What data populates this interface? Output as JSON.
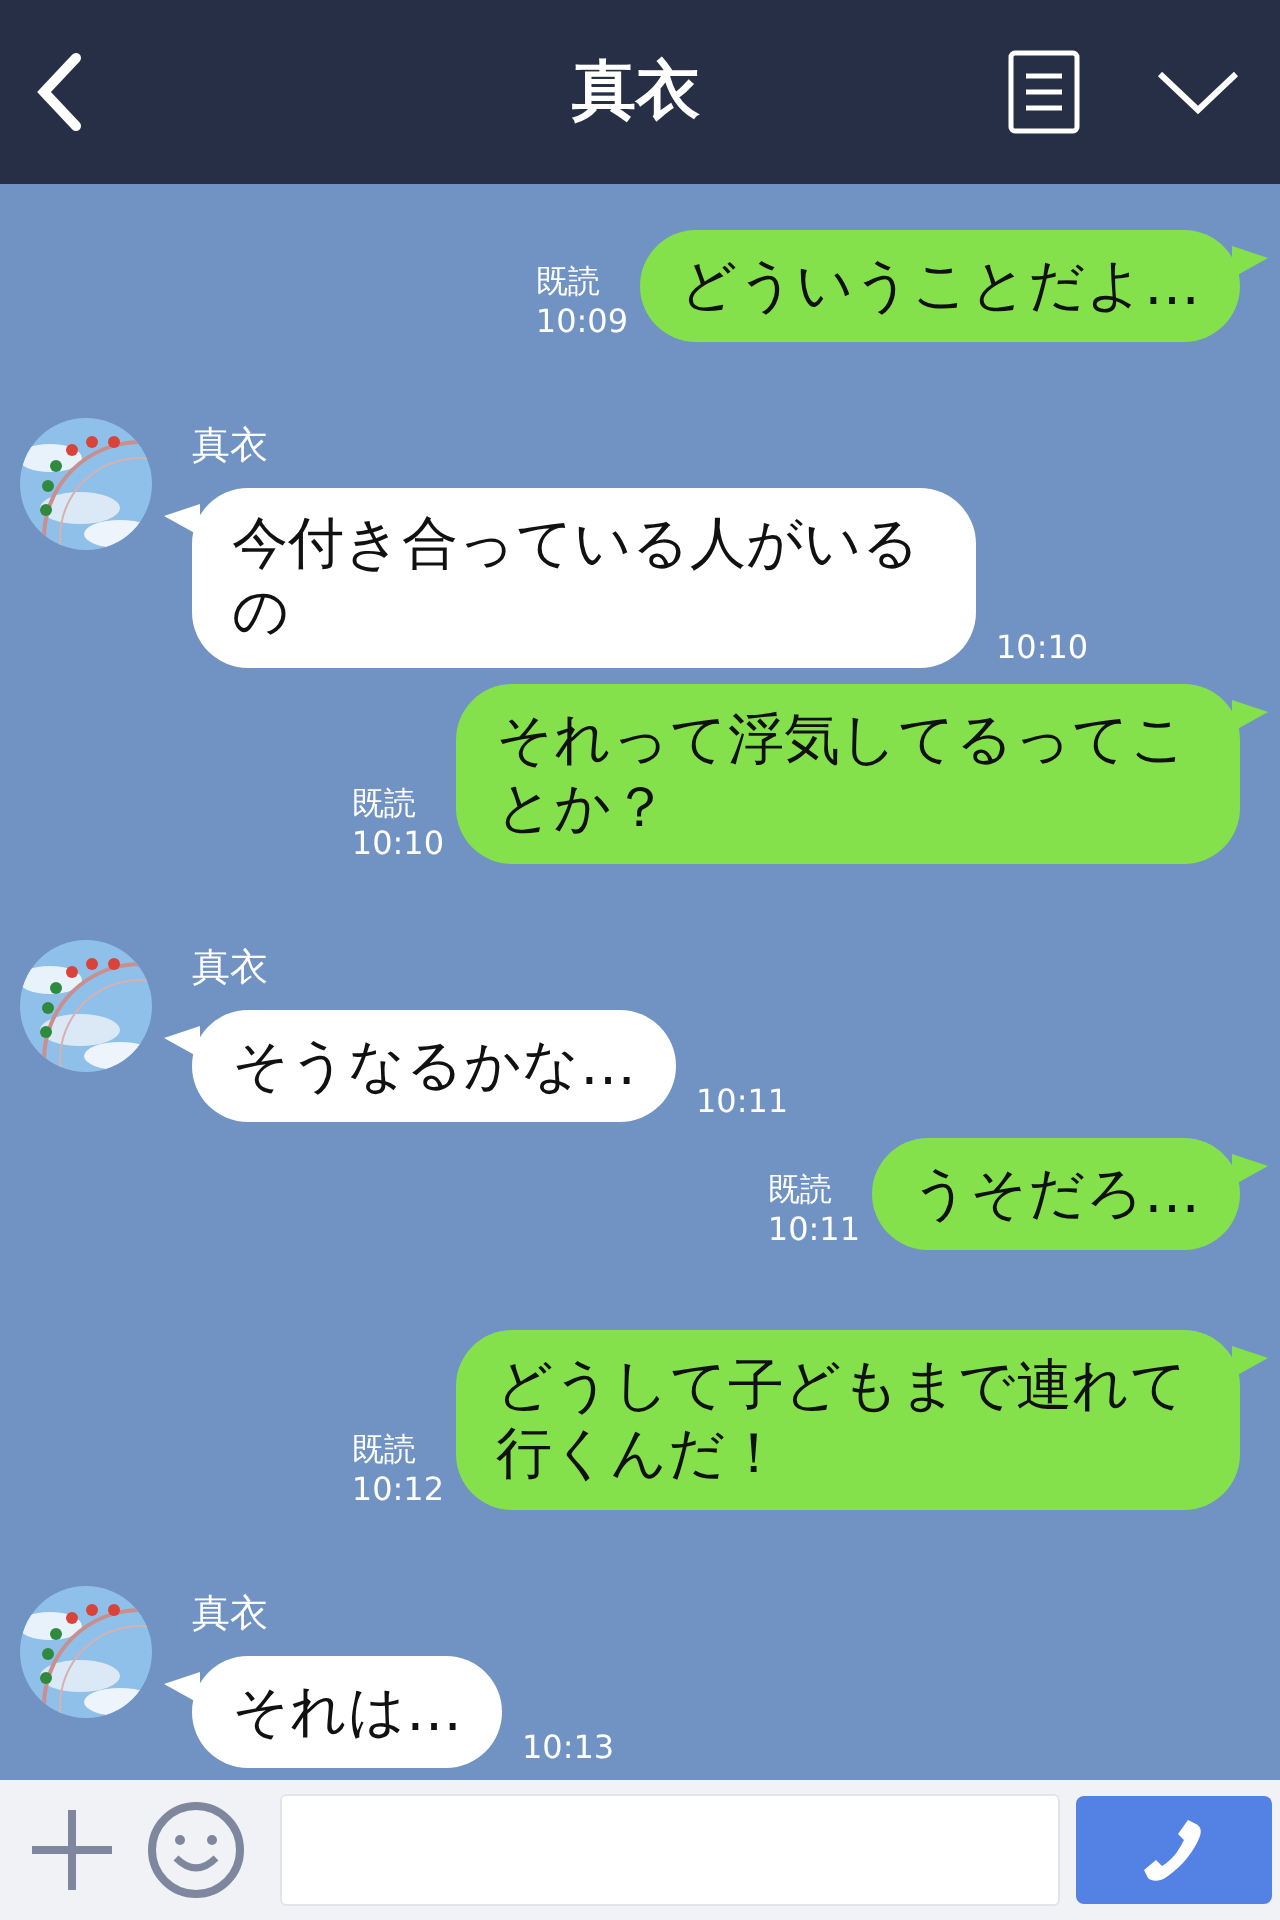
{
  "header": {
    "title": "真衣"
  },
  "messages": [
    {
      "kind": "sent",
      "text": "どういうことだよ…",
      "read": "既読",
      "time": "10:09"
    },
    {
      "kind": "received",
      "name": "真衣",
      "text": "今付き合っている人がいるの",
      "time": "10:10"
    },
    {
      "kind": "sent",
      "text": "それって浮気してるってことか？",
      "read": "既読",
      "time": "10:10"
    },
    {
      "kind": "received",
      "name": "真衣",
      "text": "そうなるかな…",
      "time": "10:11"
    },
    {
      "kind": "sent",
      "text": "うそだろ…",
      "read": "既読",
      "time": "10:11"
    },
    {
      "kind": "sent",
      "text": "どうして子どもまで連れて行くんだ！",
      "read": "既読",
      "time": "10:12"
    },
    {
      "kind": "received",
      "name": "真衣",
      "text": "それは…",
      "time": "10:13"
    }
  ]
}
